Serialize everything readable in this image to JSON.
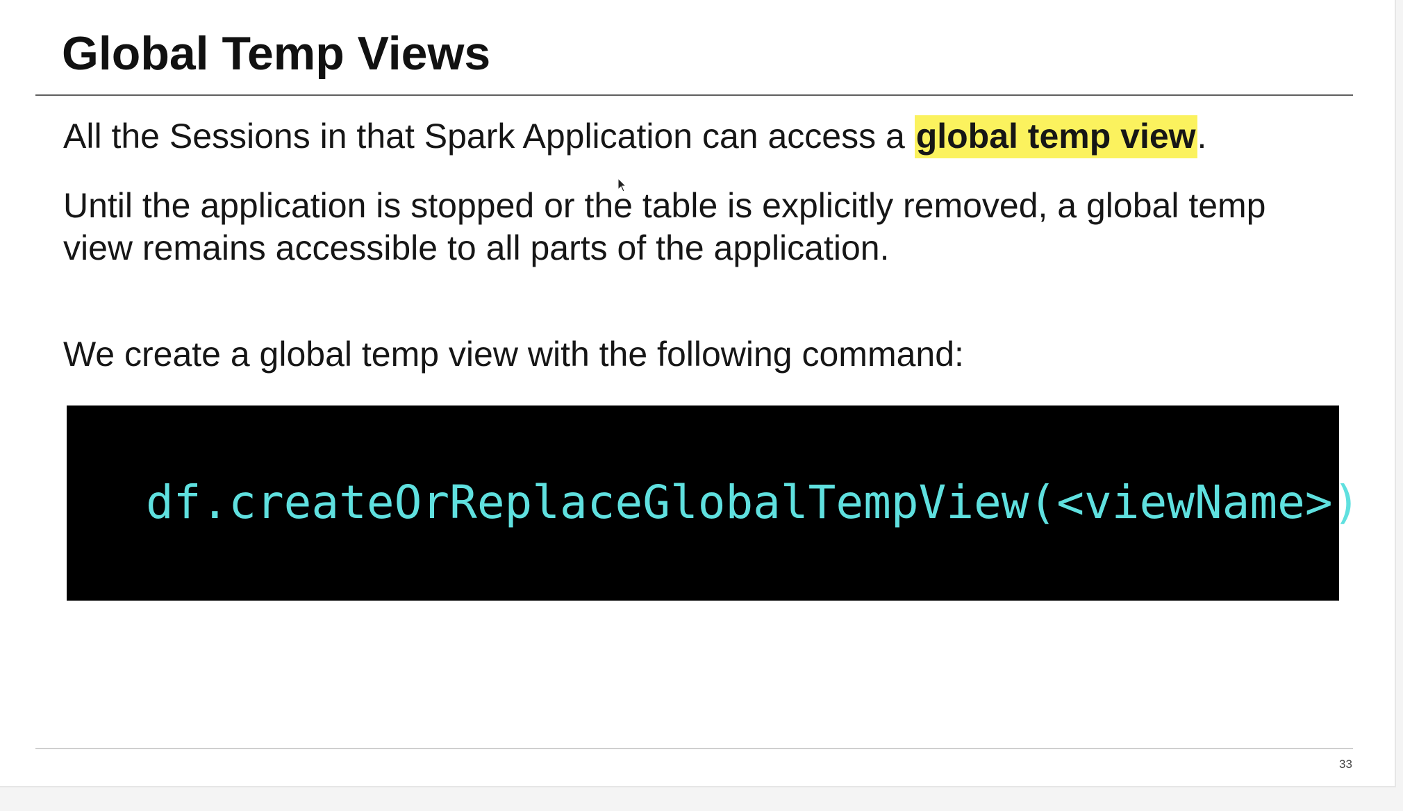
{
  "slide": {
    "title": "Global Temp Views",
    "para1_before": "All the Sessions in that Spark Application can access a ",
    "para1_highlight": "global temp view",
    "para1_after": ".",
    "para2_line1": "Until the application is stopped or the table is explicitly removed, a global temp",
    "para2_line2": "view remains accessible to all parts of the application.",
    "para3": "We create a global temp view with the following command:",
    "code": "df.createOrReplaceGlobalTempView(<viewName>)",
    "page_number": "33"
  },
  "colors": {
    "highlight": "#fbf25e",
    "code_text": "#5fe0df",
    "code_background": "#000000"
  },
  "icons": {
    "cursor": "mouse-pointer-icon"
  }
}
